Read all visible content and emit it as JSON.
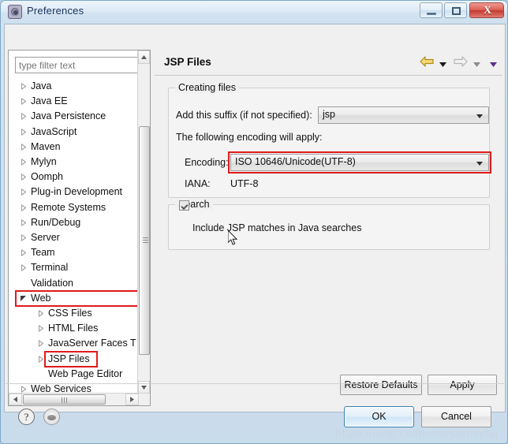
{
  "window": {
    "title": "Preferences",
    "icon": "gear-icon",
    "controls": {
      "minimize": "–",
      "maximize": "□",
      "close": "X"
    }
  },
  "filter": {
    "placeholder": "type filter text",
    "value": ""
  },
  "tree": {
    "items": [
      {
        "label": "Java",
        "indent": 0,
        "state": "collapsed"
      },
      {
        "label": "Java EE",
        "indent": 0,
        "state": "collapsed"
      },
      {
        "label": "Java Persistence",
        "indent": 0,
        "state": "collapsed"
      },
      {
        "label": "JavaScript",
        "indent": 0,
        "state": "collapsed"
      },
      {
        "label": "Maven",
        "indent": 0,
        "state": "collapsed"
      },
      {
        "label": "Mylyn",
        "indent": 0,
        "state": "collapsed"
      },
      {
        "label": "Oomph",
        "indent": 0,
        "state": "collapsed"
      },
      {
        "label": "Plug-in Development",
        "indent": 0,
        "state": "collapsed"
      },
      {
        "label": "Remote Systems",
        "indent": 0,
        "state": "collapsed"
      },
      {
        "label": "Run/Debug",
        "indent": 0,
        "state": "collapsed"
      },
      {
        "label": "Server",
        "indent": 0,
        "state": "collapsed"
      },
      {
        "label": "Team",
        "indent": 0,
        "state": "collapsed"
      },
      {
        "label": "Terminal",
        "indent": 0,
        "state": "collapsed"
      },
      {
        "label": "Validation",
        "indent": 0,
        "state": "leaf"
      },
      {
        "label": "Web",
        "indent": 0,
        "state": "expanded"
      },
      {
        "label": "CSS Files",
        "indent": 1,
        "state": "collapsed"
      },
      {
        "label": "HTML Files",
        "indent": 1,
        "state": "collapsed"
      },
      {
        "label": "JavaServer Faces T",
        "indent": 1,
        "state": "collapsed"
      },
      {
        "label": "JSP Files",
        "indent": 1,
        "state": "collapsed"
      },
      {
        "label": "Web Page Editor",
        "indent": 1,
        "state": "leaf"
      },
      {
        "label": "Web Services",
        "indent": 0,
        "state": "collapsed"
      }
    ],
    "selected_label": "JSP Files",
    "selected_index": 18,
    "annotated_indices": [
      14,
      18
    ]
  },
  "pane": {
    "title": "JSP Files",
    "nav": {
      "back_icon": "back-arrow-icon",
      "back_menu_icon": "chevron-down-icon",
      "forward_icon": "forward-arrow-icon",
      "forward_menu_icon": "chevron-down-icon",
      "view_menu_icon": "chevron-down-icon"
    },
    "creating_files": {
      "legend": "Creating files",
      "suffix_label": "Add this suffix (if not specified):",
      "suffix_value": "jsp",
      "encoding_note": "The following encoding will apply:",
      "encoding_label": "Encoding:",
      "encoding_value": "ISO 10646/Unicode(UTF-8)",
      "iana_label": "IANA:",
      "iana_value": "UTF-8"
    },
    "search": {
      "legend": "Search",
      "checkbox_label": "Include JSP matches in Java searches",
      "checkbox_checked": true
    },
    "buttons": {
      "restore_defaults": "Restore Defaults",
      "apply": "Apply"
    }
  },
  "footer": {
    "help_icon": "question-mark-icon",
    "secondary_icon": "apply-and-close-icon",
    "ok": "OK",
    "cancel": "Cancel"
  },
  "watermark": "https://blog.csdn.net/shmilyhq",
  "colors": {
    "annotation": "#e01b1b",
    "selection": "#cddff2",
    "selection_border": "#7da2ce",
    "title_text": "#15325b",
    "close_button": "#c23b30"
  }
}
